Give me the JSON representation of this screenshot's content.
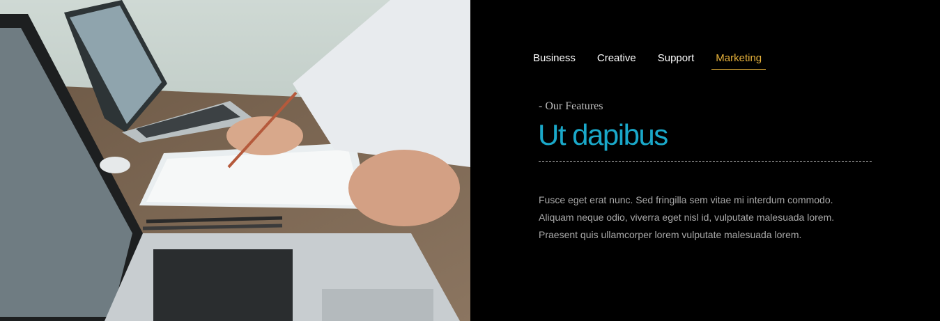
{
  "hero_image": {
    "alt": "",
    "icon": "photo-office-laptops"
  },
  "tabs": [
    {
      "label": "Business",
      "active": false
    },
    {
      "label": "Creative",
      "active": false
    },
    {
      "label": "Support",
      "active": false
    },
    {
      "label": "Marketing",
      "active": true
    }
  ],
  "feature": {
    "eyebrow": "- Our Features",
    "title": "Ut dapibus",
    "lines": [
      "Fusce eget erat nunc. Sed fringilla sem vitae mi interdum commodo.",
      "Aliquam neque odio, viverra eget nisl id, vulputate malesuada lorem.",
      "Praesent quis ullamcorper lorem vulputate malesuada lorem."
    ]
  },
  "colors": {
    "background": "#000000",
    "accent_tab": "#e6b13b",
    "title": "#1aa8c9",
    "body_text": "#a9a9a9"
  }
}
